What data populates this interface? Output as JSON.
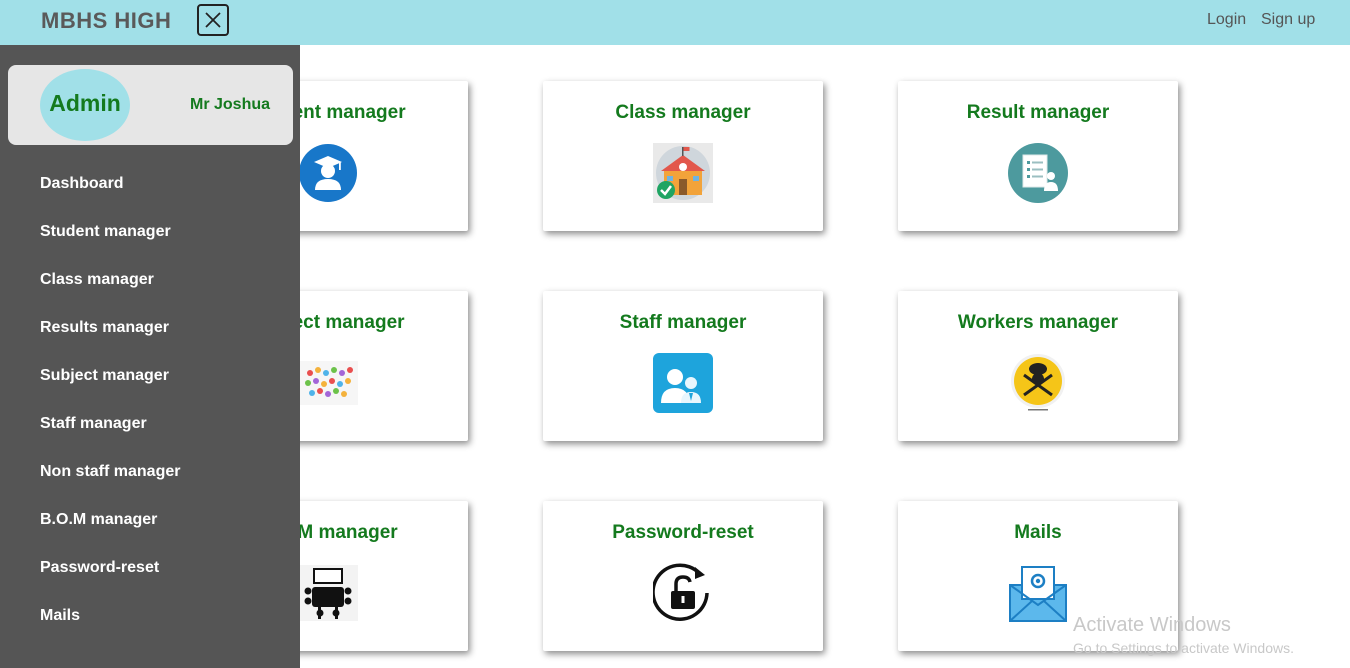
{
  "header": {
    "brand": "MBHS HIGH",
    "close_icon": "close-icon",
    "login": "Login",
    "signup": "Sign up",
    "background": "#a1e0e8"
  },
  "sidebar": {
    "profile": {
      "role": "Admin",
      "name": "Mr Joshua"
    },
    "items": [
      {
        "label": "Dashboard"
      },
      {
        "label": "Student manager"
      },
      {
        "label": "Class manager"
      },
      {
        "label": "Results manager"
      },
      {
        "label": "Subject manager"
      },
      {
        "label": "Staff manager"
      },
      {
        "label": "Non staff manager"
      },
      {
        "label": "B.O.M manager"
      },
      {
        "label": "Password-reset"
      },
      {
        "label": "Mails"
      }
    ]
  },
  "cards": [
    {
      "title": "Student manager",
      "icon": "graduate-icon"
    },
    {
      "title": "Class manager",
      "icon": "school-building-icon"
    },
    {
      "title": "Result manager",
      "icon": "report-icon"
    },
    {
      "title": "Subject manager",
      "icon": "subjects-icon"
    },
    {
      "title": "Staff manager",
      "icon": "staff-icon"
    },
    {
      "title": "Workers manager",
      "icon": "chef-icon"
    },
    {
      "title": "B.O.M manager",
      "icon": "board-meeting-icon"
    },
    {
      "title": "Password-reset",
      "icon": "unlock-icon"
    },
    {
      "title": "Mails",
      "icon": "mail-icon"
    }
  ],
  "watermark": {
    "line1": "Activate Windows",
    "line2": "Go to Settings to activate Windows."
  },
  "colors": {
    "accent_green": "#147a1e",
    "sidebar_bg": "#555555",
    "header_bg": "#a1e0e8"
  }
}
